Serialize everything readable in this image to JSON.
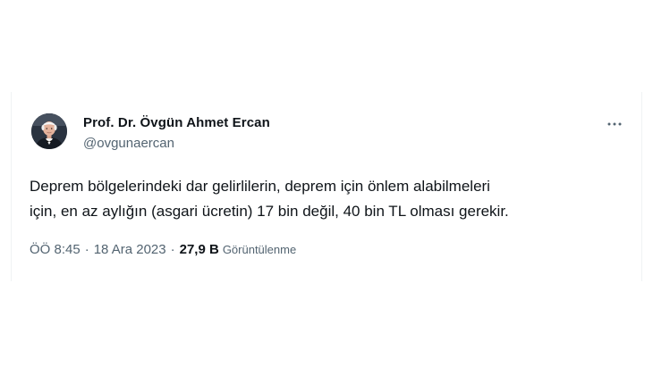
{
  "tweet": {
    "author": {
      "name": "Prof. Dr. Övgün Ahmet Ercan",
      "handle": "@ovgunaercan",
      "avatar_icon": "profile-photo"
    },
    "more_icon": "more-horizontal-icon",
    "text_lines": [
      "Deprem bölgelerindeki dar gelirlilerin, deprem için önlem alabilmeleri",
      "için, en az aylığın (asgari ücretin) 17 bin değil, 40 bin TL olması gerekir."
    ],
    "time": "ÖÖ 8:45",
    "separator": "·",
    "date": "18 Ara 2023",
    "views_count": "27,9 B",
    "views_label": "Görüntülenme"
  },
  "colors": {
    "text_primary": "#0f1419",
    "text_secondary": "#536471",
    "border": "#eff3f4",
    "background": "#ffffff"
  }
}
